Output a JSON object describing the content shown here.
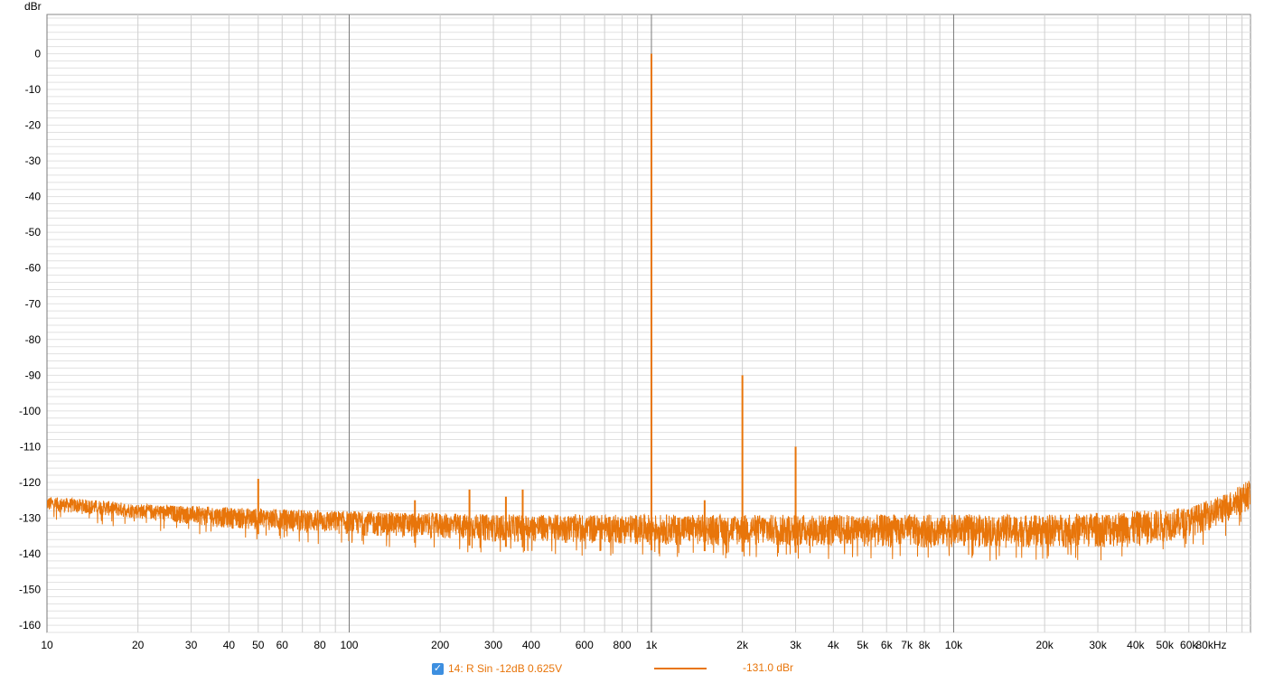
{
  "chart_data": {
    "type": "line",
    "xscale": "log",
    "xlim": [
      10,
      96000
    ],
    "ylim": [
      -162,
      11
    ],
    "ylabel": "dBr",
    "y_ticks": [
      {
        "value": 0,
        "label": "0"
      },
      {
        "value": -10,
        "label": "-10"
      },
      {
        "value": -20,
        "label": "-20"
      },
      {
        "value": -30,
        "label": "-30"
      },
      {
        "value": -40,
        "label": "-40"
      },
      {
        "value": -50,
        "label": "-50"
      },
      {
        "value": -60,
        "label": "-60"
      },
      {
        "value": -70,
        "label": "-70"
      },
      {
        "value": -80,
        "label": "-80"
      },
      {
        "value": -90,
        "label": "-90"
      },
      {
        "value": -100,
        "label": "-100"
      },
      {
        "value": -110,
        "label": "-110"
      },
      {
        "value": -120,
        "label": "-120"
      },
      {
        "value": -130,
        "label": "-130"
      },
      {
        "value": -140,
        "label": "-140"
      },
      {
        "value": -150,
        "label": "-150"
      },
      {
        "value": -160,
        "label": "-160"
      }
    ],
    "x_ticks": [
      {
        "value": 10,
        "label": "10"
      },
      {
        "value": 20,
        "label": "20"
      },
      {
        "value": 30,
        "label": "30"
      },
      {
        "value": 40,
        "label": "40"
      },
      {
        "value": 50,
        "label": "50"
      },
      {
        "value": 60,
        "label": "60"
      },
      {
        "value": 80,
        "label": "80"
      },
      {
        "value": 100,
        "label": "100"
      },
      {
        "value": 200,
        "label": "200"
      },
      {
        "value": 300,
        "label": "300"
      },
      {
        "value": 400,
        "label": "400"
      },
      {
        "value": 600,
        "label": "600"
      },
      {
        "value": 800,
        "label": "800"
      },
      {
        "value": 1000,
        "label": "1k"
      },
      {
        "value": 2000,
        "label": "2k"
      },
      {
        "value": 3000,
        "label": "3k"
      },
      {
        "value": 4000,
        "label": "4k"
      },
      {
        "value": 5000,
        "label": "5k"
      },
      {
        "value": 6000,
        "label": "6k"
      },
      {
        "value": 7000,
        "label": "7k"
      },
      {
        "value": 8000,
        "label": "8k"
      },
      {
        "value": 10000,
        "label": "10k"
      },
      {
        "value": 20000,
        "label": "20k"
      },
      {
        "value": 30000,
        "label": "30k"
      },
      {
        "value": 40000,
        "label": "40k"
      },
      {
        "value": 50000,
        "label": "50k"
      },
      {
        "value": 60000,
        "label": "60k"
      },
      {
        "value": 80000,
        "label": "80kHz"
      }
    ],
    "grid": true,
    "series": [
      {
        "name": "14: R Sin -12dB 0.625V",
        "color": "#e8750a",
        "readout": "-131.0 dBr",
        "spectrum": {
          "noise_floor": [
            {
              "x": 10,
              "y_top": -124,
              "y_bottom": -129
            },
            {
              "x": 15,
              "y_top": -125,
              "y_bottom": -130
            },
            {
              "x": 20,
              "y_top": -126,
              "y_bottom": -131
            },
            {
              "x": 40,
              "y_top": -127,
              "y_bottom": -134
            },
            {
              "x": 100,
              "y_top": -128,
              "y_bottom": -136
            },
            {
              "x": 300,
              "y_top": -129,
              "y_bottom": -138
            },
            {
              "x": 1000,
              "y_top": -129,
              "y_bottom": -139
            },
            {
              "x": 5000,
              "y_top": -129,
              "y_bottom": -140
            },
            {
              "x": 20000,
              "y_top": -129,
              "y_bottom": -140
            },
            {
              "x": 40000,
              "y_top": -128,
              "y_bottom": -140
            },
            {
              "x": 60000,
              "y_top": -127,
              "y_bottom": -137
            },
            {
              "x": 80000,
              "y_top": -123,
              "y_bottom": -133
            },
            {
              "x": 96000,
              "y_top": -119,
              "y_bottom": -129
            }
          ],
          "peaks": [
            {
              "x": 50,
              "y": -119
            },
            {
              "x": 165,
              "y": -125
            },
            {
              "x": 250,
              "y": -122
            },
            {
              "x": 330,
              "y": -124
            },
            {
              "x": 375,
              "y": -122
            },
            {
              "x": 1000,
              "y": 0
            },
            {
              "x": 1500,
              "y": -125
            },
            {
              "x": 2000,
              "y": -90
            },
            {
              "x": 3000,
              "y": -110
            }
          ]
        }
      }
    ]
  }
}
